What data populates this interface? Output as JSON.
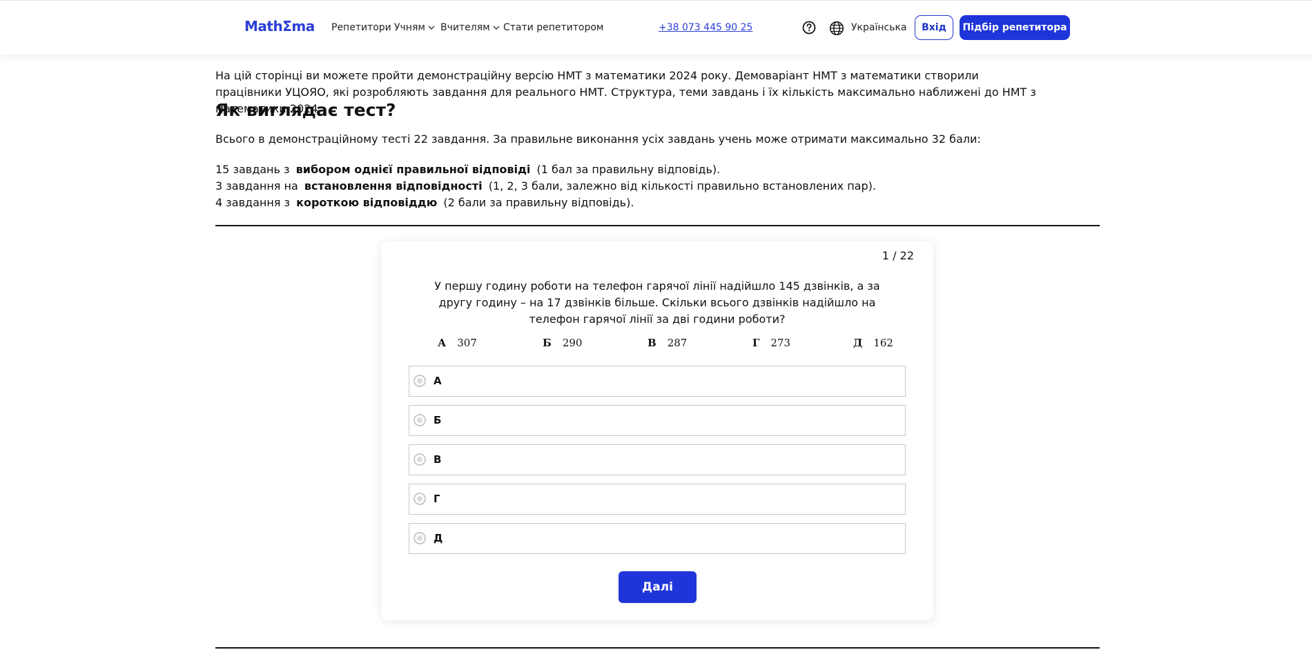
{
  "header": {
    "logo": "MathΣma",
    "nav": {
      "tutors": "Репетитори",
      "students": "Учням",
      "teachers": "Вчителям",
      "become_tutor": "Стати репетитором"
    },
    "phone": "+38 073 445 90 25",
    "language": "Українська",
    "login_label": "Вхід",
    "tutor_match_label": "Підбір репетитора"
  },
  "intro": {
    "paragraph": "На цій сторінці ви можете пройти демонстраційну версію НМТ з математики 2024 року. Демоваріант НМТ з математики створили працівники УЦОЯО, які розробляють завдання для реального НМТ. Структура, теми завдань і їх кількість максимально наближені до НМТ з математики 2024.",
    "heading": "Як виглядає тест?",
    "summary": "Всього в демонстраційному тесті 22 завдання. За правильне виконання усіх завдань учень може отримати максимально 32 бали:",
    "items": [
      {
        "prefix": "15 завдань з",
        "bold": "вибором однієї правильної відповіді",
        "suffix": "(1 бал за правильну відповідь)."
      },
      {
        "prefix": "3 завдання на",
        "bold": "встановлення відповідності",
        "suffix": "(1, 2, 3 бали, залежно від кількості правильно встановлених пар)."
      },
      {
        "prefix": "4 завдання з",
        "bold": "короткою відповіддю",
        "suffix": "(2 бали за правильну відповідь)."
      }
    ]
  },
  "quiz": {
    "counter": "1 / 22",
    "question": "У першу годину роботи на телефон гарячої лінії надійшло 145 дзвінків, а за другу годину – на 17 дзвінків більше. Скільки всього дзвінків надійшло на телефон гарячої лінії за дві години роботи?",
    "answer_options": [
      {
        "letter": "А",
        "value": "307"
      },
      {
        "letter": "Б",
        "value": "290"
      },
      {
        "letter": "В",
        "value": "287"
      },
      {
        "letter": "Г",
        "value": "273"
      },
      {
        "letter": "Д",
        "value": "162"
      }
    ],
    "choices": [
      "А",
      "Б",
      "В",
      "Г",
      "Д"
    ],
    "next_label": "Далі"
  }
}
